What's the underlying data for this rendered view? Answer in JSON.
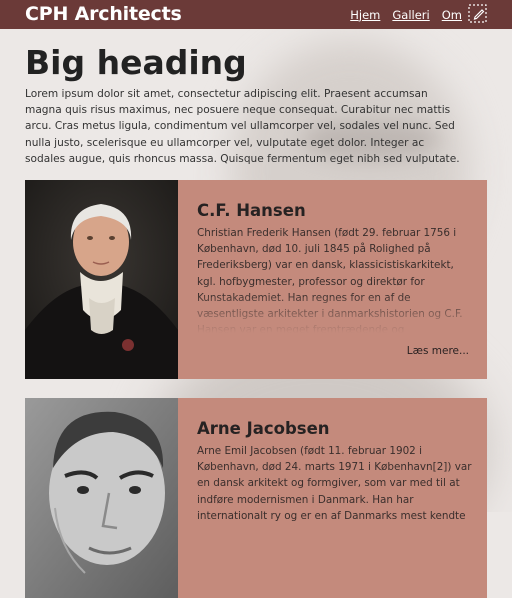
{
  "header": {
    "brand": "CPH Architects",
    "nav": [
      "Hjem",
      "Galleri",
      "Om"
    ],
    "edit_icon": "edit-pencil-icon"
  },
  "main": {
    "heading": "Big heading",
    "intro": "Lorem ipsum dolor sit amet, consectetur adipiscing elit. Praesent accumsan magna quis risus maximus, nec posuere neque consequat. Curabitur nec mattis arcu. Cras metus ligula, condimentum vel ullamcorper vel, sodales vel nunc. Sed nulla justo, scelerisque eu ullamcorper vel, vulputate eget dolor. Integer ac sodales augue, quis rhoncus massa. Quisque fermentum eget nibh sed vulputate."
  },
  "cards": [
    {
      "name": "C.F. Hansen",
      "text": "Christian Frederik Hansen (født 29. februar 1756 i København, død 10. juli 1845 på Rolighed på Frederiksberg) var en dansk, klassicistiskarkitekt, kgl. hofbygmester, professor og direktør for Kunstakademiet. Han regnes for en af de væsentligste arkitekter i danmarkshistorien og C.F. Hansen var en meget fremtrædende og indflydelsesrig arkitekt i",
      "read_more": "Læs mere..."
    },
    {
      "name": "Arne Jacobsen",
      "text": "Arne Emil Jacobsen (født 11. februar 1902 i København, død 24. marts 1971 i København[2]) var en dansk arkitekt og formgiver, som var med til at indføre modernismen i Danmark. Han har internationalt ry og er en af Danmarks mest kendte"
    }
  ],
  "colors": {
    "header": "#6b3a38",
    "card": "#c48a7c",
    "page": "#ece8e6"
  }
}
